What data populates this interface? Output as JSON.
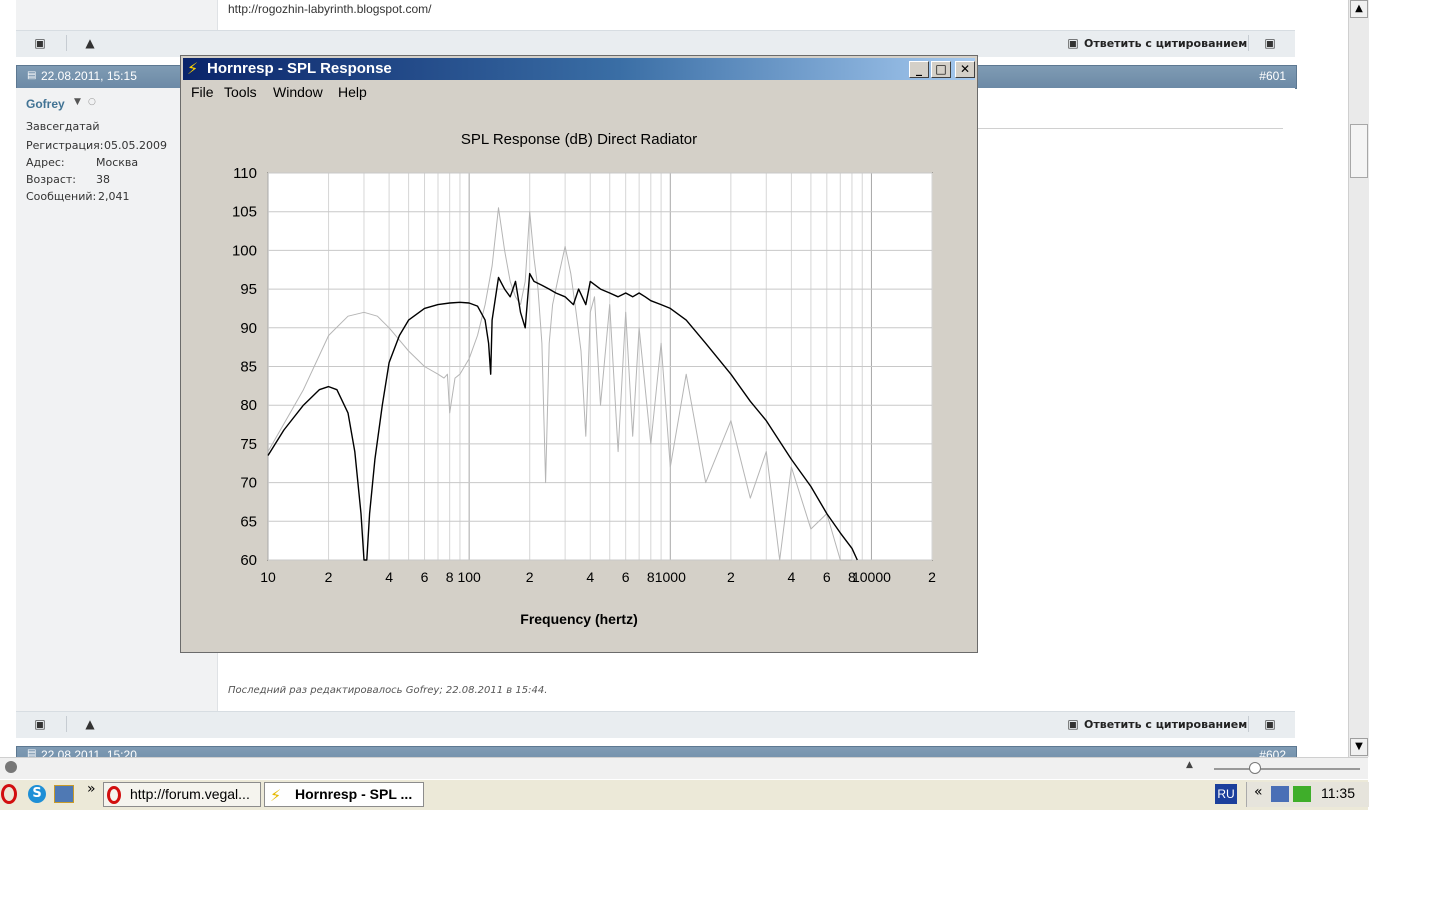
{
  "forum": {
    "top_link": "http://rogozhin-labyrinth.blogspot.com/",
    "reply_quote_label": "Ответить с цитированием",
    "post": {
      "date": "22.08.2011, 15:15",
      "number": "#601",
      "user_name": "Gofrey",
      "user_title": "Завсегдатай",
      "reg_label": "Регистрация:",
      "reg_value": "05.05.2009",
      "addr_label": "Адрес:",
      "addr_value": "Москва",
      "age_label": "Возраст:",
      "age_value": "38",
      "msgs_label": "Сообщений:",
      "msgs_value": "2,041",
      "edited_note": "Последний раз редактировалось Gofrey; 22.08.2011 в 15:44."
    },
    "next_post": {
      "date": "22.08.2011, 15:20",
      "number": "#602"
    }
  },
  "window": {
    "title": "Hornresp - SPL Response",
    "menu": [
      "File",
      "Tools",
      "Window",
      "Help"
    ],
    "chart_title": "SPL Response (dB)   Direct Radiator",
    "xlabel": "Frequency (hertz)"
  },
  "taskbar": {
    "items": [
      "http://forum.vegal...",
      "Hornresp - SPL ..."
    ],
    "lang": "RU",
    "clock": "11:35"
  },
  "colors": {
    "header_blue": "#6c8aa6",
    "title_start": "#0a246a",
    "title_end": "#a6caf0",
    "curve_black": "#000000",
    "curve_gray": "#b5b5b5"
  },
  "chart_data": {
    "type": "line",
    "title": "SPL Response (dB)   Direct Radiator",
    "xlabel": "Frequency (hertz)",
    "ylabel": "",
    "x_scale": "log",
    "xlim": [
      10,
      20000
    ],
    "ylim": [
      60,
      110
    ],
    "yticks": [
      60,
      65,
      70,
      75,
      80,
      85,
      90,
      95,
      100,
      105,
      110
    ],
    "xtick_labels": [
      {
        "value": 10,
        "label": "10"
      },
      {
        "value": 20,
        "label": "2"
      },
      {
        "value": 40,
        "label": "4"
      },
      {
        "value": 60,
        "label": "6"
      },
      {
        "value": 80,
        "label": "8"
      },
      {
        "value": 100,
        "label": "100"
      },
      {
        "value": 200,
        "label": "2"
      },
      {
        "value": 400,
        "label": "4"
      },
      {
        "value": 600,
        "label": "6"
      },
      {
        "value": 800,
        "label": "8"
      },
      {
        "value": 1000,
        "label": "1000"
      },
      {
        "value": 2000,
        "label": "2"
      },
      {
        "value": 4000,
        "label": "4"
      },
      {
        "value": 6000,
        "label": "6"
      },
      {
        "value": 8000,
        "label": "8"
      },
      {
        "value": 10000,
        "label": "10000"
      },
      {
        "value": 20000,
        "label": "2"
      }
    ],
    "grid": true,
    "series": [
      {
        "color": "#000000",
        "x": [
          10,
          12,
          15,
          18,
          20,
          22,
          25,
          27,
          29,
          30,
          31,
          32,
          34,
          37,
          40,
          45,
          50,
          60,
          70,
          80,
          90,
          100,
          110,
          120,
          125,
          128,
          130,
          140,
          150,
          160,
          165,
          170,
          180,
          190,
          200,
          210,
          230,
          250,
          270,
          300,
          330,
          350,
          380,
          400,
          450,
          500,
          550,
          600,
          650,
          700,
          750,
          800,
          900,
          1000,
          1200,
          1500,
          2000,
          2500,
          3000,
          4000,
          5000,
          6000,
          7000,
          8000,
          8500
        ],
        "y": [
          73.5,
          76.8,
          80.0,
          82.0,
          82.4,
          82.0,
          79.0,
          74.0,
          66.0,
          60.0,
          60.0,
          66.0,
          73.0,
          80.0,
          85.5,
          89.0,
          91.0,
          92.5,
          93.0,
          93.2,
          93.3,
          93.2,
          92.8,
          91.0,
          88.0,
          84.0,
          91.0,
          96.5,
          95.0,
          94.0,
          95.0,
          96.0,
          92.0,
          90.0,
          97.0,
          96.0,
          95.5,
          95.0,
          94.5,
          94.0,
          93.0,
          95.0,
          93.0,
          96.0,
          95.0,
          94.5,
          94.0,
          94.5,
          94.0,
          94.5,
          94.0,
          93.5,
          93.0,
          92.5,
          91.0,
          88.0,
          84.0,
          80.5,
          78.0,
          73.0,
          69.5,
          66.0,
          63.5,
          61.5,
          60.0
        ]
      },
      {
        "color": "#b5b5b5",
        "x": [
          10,
          15,
          20,
          25,
          30,
          35,
          40,
          50,
          60,
          70,
          75,
          78,
          80,
          85,
          90,
          100,
          110,
          120,
          130,
          140,
          150,
          160,
          170,
          180,
          190,
          200,
          210,
          220,
          230,
          240,
          250,
          260,
          280,
          300,
          320,
          340,
          360,
          380,
          400,
          420,
          450,
          500,
          550,
          600,
          650,
          700,
          800,
          900,
          1000,
          1200,
          1500,
          2000,
          2500,
          3000,
          3500,
          4000,
          5000,
          6000,
          7000,
          8000
        ],
        "y": [
          74.0,
          82.0,
          89.0,
          91.5,
          92.0,
          91.5,
          90.0,
          87.0,
          85.0,
          84.0,
          83.5,
          84.0,
          79.0,
          83.5,
          84.0,
          86.0,
          89.0,
          93.0,
          98.0,
          105.5,
          100.0,
          96.0,
          94.0,
          93.0,
          96.0,
          105.0,
          99.0,
          95.0,
          88.0,
          70.0,
          88.0,
          93.0,
          97.0,
          100.5,
          97.0,
          92.0,
          87.0,
          76.0,
          92.0,
          94.0,
          80.0,
          93.0,
          74.0,
          92.0,
          76.0,
          90.0,
          75.0,
          88.0,
          72.0,
          84.0,
          70.0,
          78.0,
          68.0,
          74.0,
          60.0,
          72.0,
          64.0,
          66.0,
          60.0,
          60.0
        ]
      }
    ]
  }
}
